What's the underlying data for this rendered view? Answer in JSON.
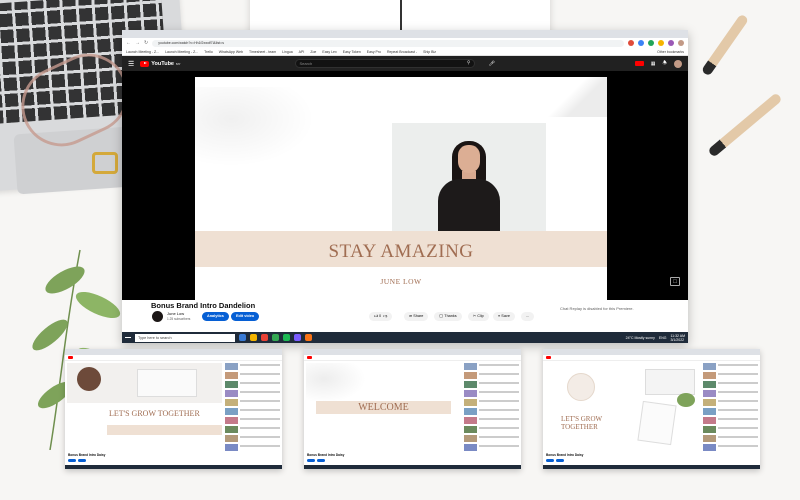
{
  "browser": {
    "url": "youtube.com/watch?v=Hh1f2xwdf7I&list=s",
    "bookmarks": [
      "Launch Meeting - Z...",
      "Launch Meeting - Z...",
      "Trello",
      "WhatsApp Web",
      "Timesheet - team",
      "Lingua",
      "API",
      "Zoe",
      "Easy Lex",
      "Easy Token",
      "Easy Pro",
      "Repeat Broadcast -",
      "Ship Biz"
    ],
    "other_bookmarks": "Other bookmarks"
  },
  "youtube": {
    "logo_text": "YouTube",
    "logo_region": "MY",
    "search_placeholder": "Search"
  },
  "video": {
    "headline": "STAY AMAZING",
    "name": "JUNE LOW",
    "title": "Bonus Brand Intro Dandelion",
    "channel": "June Low",
    "subscribers": "1.25 subscribers",
    "analytics_label": "Analytics",
    "edit_label": "Edit video",
    "likes": "0",
    "share_label": "Share",
    "thanks_label": "Thanks",
    "clip_label": "Clip",
    "save_label": "Save",
    "more_label": "...",
    "chat_note": "Chat Replay is disabled for this Premiere."
  },
  "taskbar": {
    "search_placeholder": "Type here to search",
    "weather": "24°C  Mostly sunny",
    "lang": "ENG",
    "time": "11:32 AM",
    "date": "3/1/2022"
  },
  "thumbnails": [
    {
      "headline": "LET'S GROW TOGETHER",
      "title": "Bonus Brand Intro Daisy"
    },
    {
      "headline": "WELCOME",
      "title": "Bonus Brand Intro Daisy"
    },
    {
      "headline": "LET'S GROW TOGETHER",
      "title": "Bonus Brand Intro Daisy"
    }
  ],
  "colors": {
    "accent_text": "#a06d52",
    "band": "#efe0d3",
    "youtube_blue": "#065fd4",
    "youtube_dark": "#212121"
  }
}
